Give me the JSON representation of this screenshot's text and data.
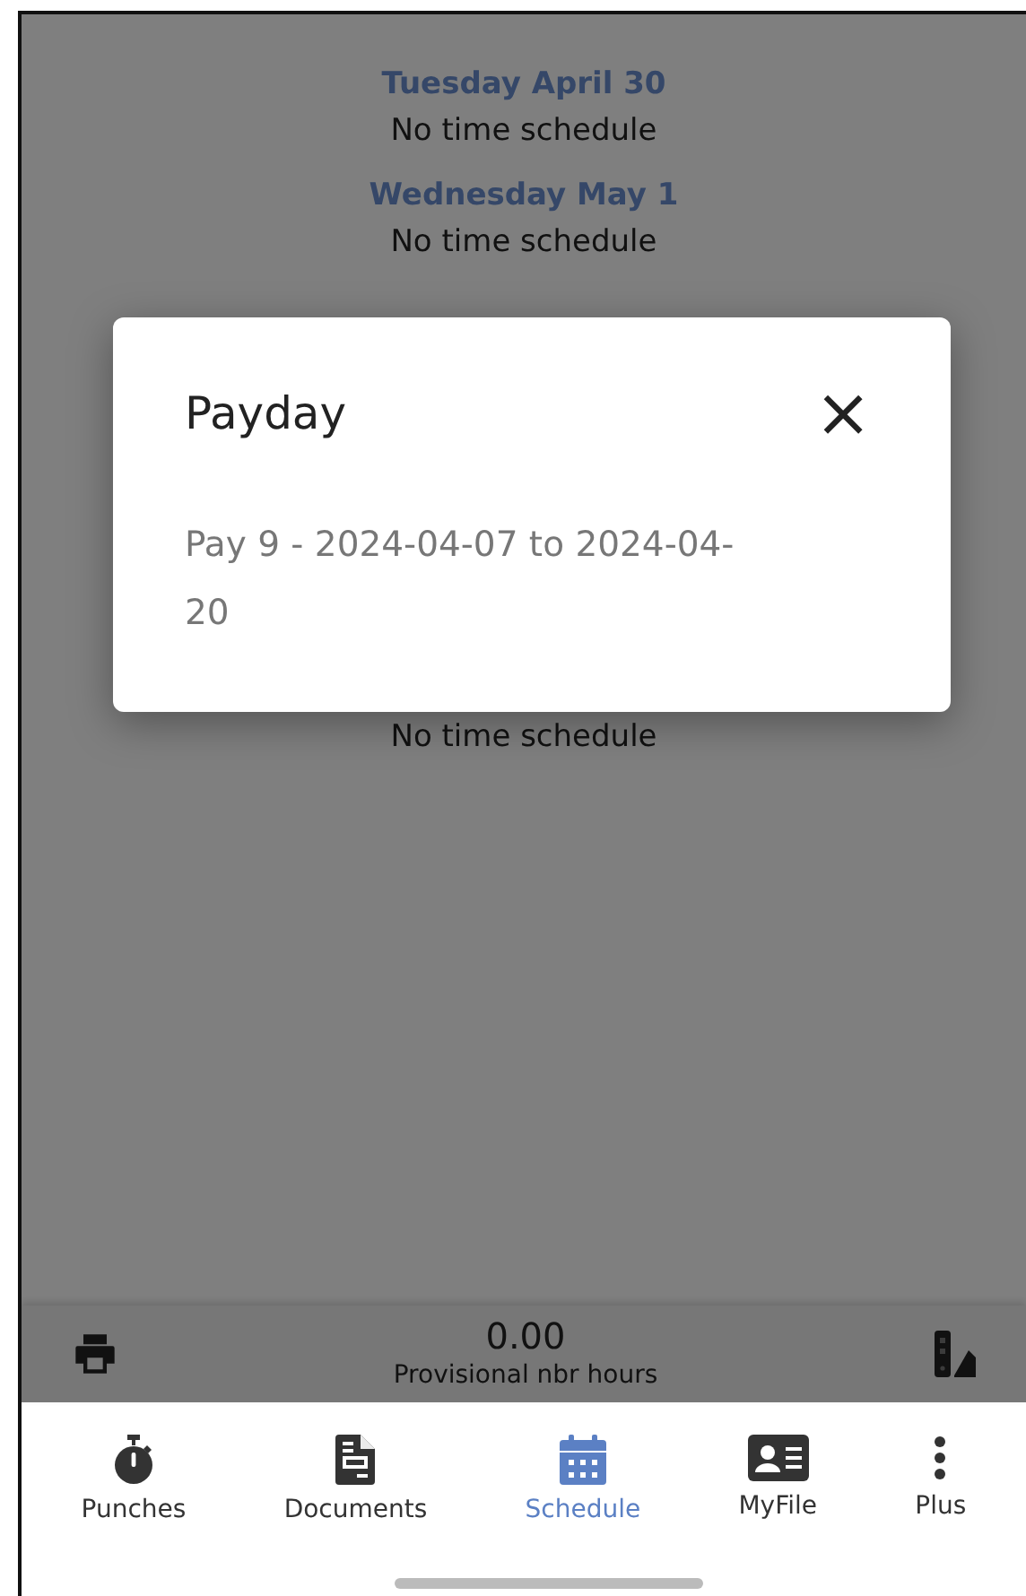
{
  "schedule": [
    {
      "heading": "Tuesday April 30",
      "text": "No time schedule"
    },
    {
      "heading": "Wednesday May 1",
      "text": "No time schedule"
    },
    {
      "text": "No time schedule"
    }
  ],
  "dialog": {
    "title": "Payday",
    "close": "×",
    "body": "Pay 9 - 2024-04-07 to 2024-04-20"
  },
  "summary": {
    "value": "0.00",
    "label": "Provisional nbr hours"
  },
  "tabs": [
    {
      "label": "Punches",
      "kind": "stopwatch",
      "selected": false
    },
    {
      "label": "Documents",
      "kind": "document",
      "selected": false
    },
    {
      "label": "Schedule",
      "kind": "calendar",
      "selected": true
    },
    {
      "label": "MyFile",
      "kind": "card",
      "selected": false
    },
    {
      "label": "Plus",
      "kind": "dots",
      "selected": false
    }
  ]
}
